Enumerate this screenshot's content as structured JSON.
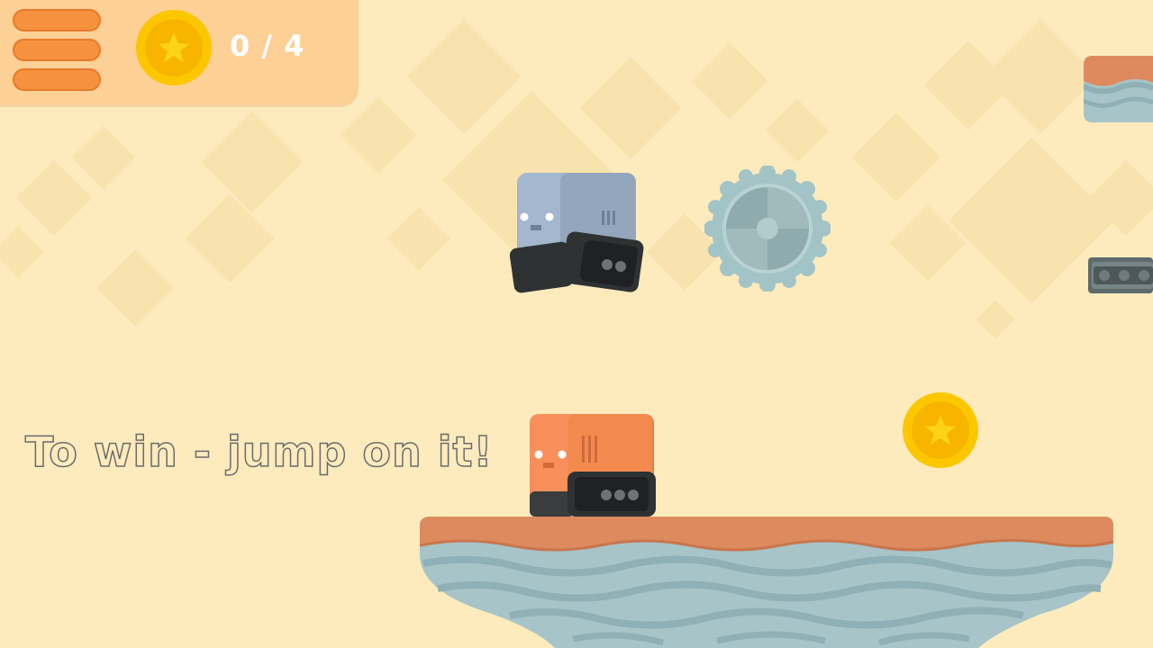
{
  "hud": {
    "coins_collected": "0 / 4",
    "menu_icon": "hamburger-menu-icon",
    "coin_icon": "gold-star-coin-icon"
  },
  "hint": {
    "text": "To win - jump on it!"
  },
  "colors": {
    "background": "#fdebbd",
    "hud_panel": "#fdd095",
    "menu_bars": "#f6923e",
    "coin": "#fdc700",
    "platform_top": "#de8a5f",
    "water": "#a7c4c8",
    "blue_robot": "#9fb4cc",
    "orange_robot": "#f6894f",
    "saw": "#a3c4c6"
  },
  "level": {
    "entities": [
      "blue-robot",
      "orange-robot",
      "spinning-saw",
      "gold-coin",
      "main-platform",
      "top-right-platform",
      "metal-rail"
    ]
  }
}
